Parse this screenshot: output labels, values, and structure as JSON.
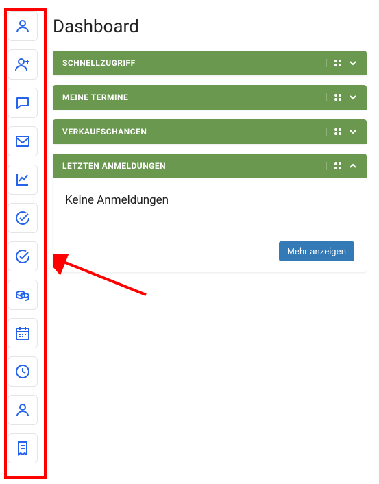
{
  "page": {
    "title": "Dashboard"
  },
  "sidebar": {
    "items": [
      {
        "icon": "person-icon"
      },
      {
        "icon": "person-plus-icon"
      },
      {
        "icon": "chat-icon"
      },
      {
        "icon": "mail-icon"
      },
      {
        "icon": "chart-icon"
      },
      {
        "icon": "check-circle-icon"
      },
      {
        "icon": "check-circle-icon"
      },
      {
        "icon": "coins-icon"
      },
      {
        "icon": "calendar-icon"
      },
      {
        "icon": "clock-icon"
      },
      {
        "icon": "person-icon"
      },
      {
        "icon": "note-icon"
      }
    ]
  },
  "panels": [
    {
      "title": "SCHNELLZUGRIFF",
      "expanded": false
    },
    {
      "title": "MEINE TERMINE",
      "expanded": false
    },
    {
      "title": "VERKAUFSCHANCEN",
      "expanded": false
    },
    {
      "title": "LETZTEN ANMELDUNGEN",
      "expanded": true,
      "empty_text": "Keine Anmeldungen",
      "more_label": "Mehr anzeigen"
    }
  ]
}
